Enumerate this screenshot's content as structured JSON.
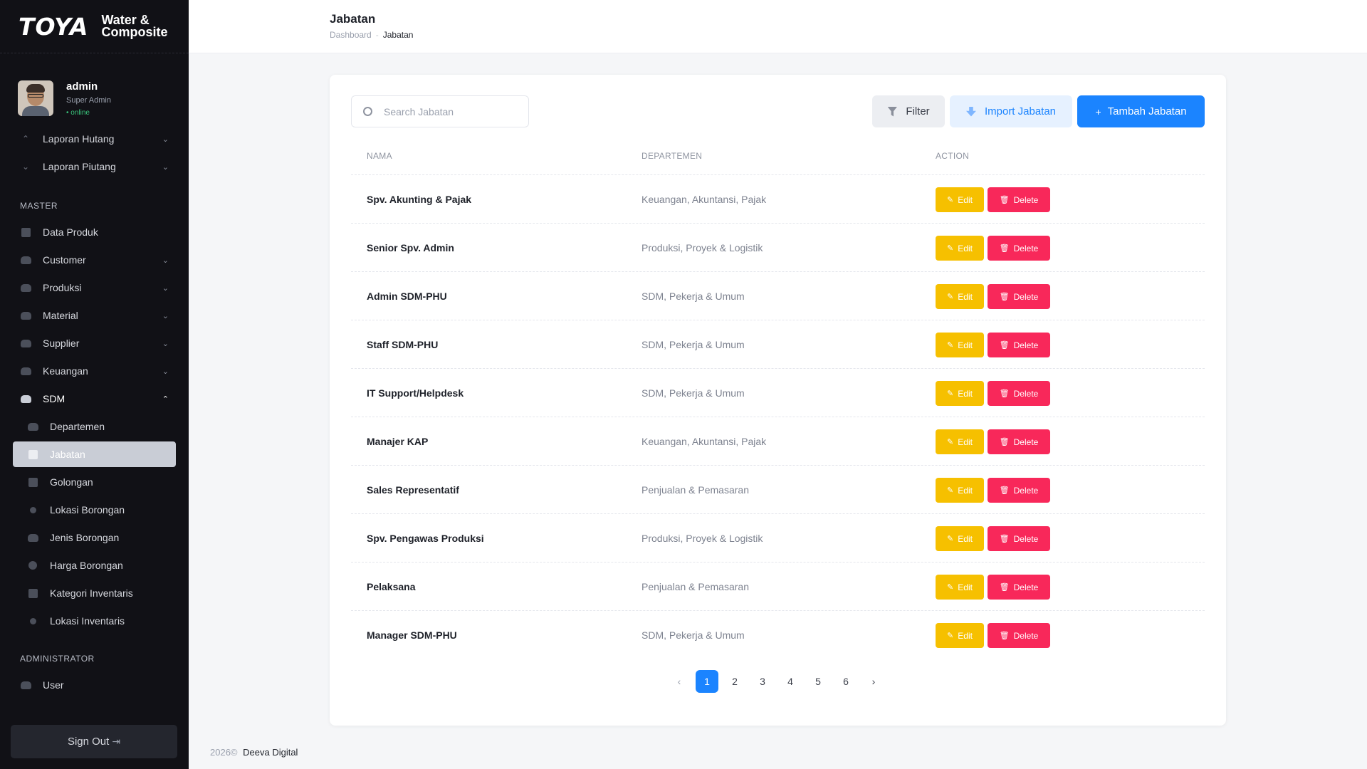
{
  "brand": {
    "logo": "TOYA",
    "subtitle_line1": "Water &",
    "subtitle_line2": "Composite"
  },
  "profile": {
    "name": "admin",
    "role": "Super Admin",
    "status": "• online"
  },
  "sidebar": {
    "top_items": [
      {
        "label": "Laporan Hutang",
        "icon": "arrow-up-icon"
      },
      {
        "label": "Laporan Piutang",
        "icon": "arrow-down-icon"
      }
    ],
    "master_label": "MASTER",
    "master_items": [
      {
        "label": "Data Produk"
      },
      {
        "label": "Customer"
      },
      {
        "label": "Produksi"
      },
      {
        "label": "Material"
      },
      {
        "label": "Supplier"
      },
      {
        "label": "Keuangan"
      },
      {
        "label": "SDM"
      }
    ],
    "sdm_items": [
      {
        "label": "Departemen"
      },
      {
        "label": "Jabatan"
      },
      {
        "label": "Golongan"
      },
      {
        "label": "Lokasi Borongan"
      },
      {
        "label": "Jenis Borongan"
      },
      {
        "label": "Harga Borongan"
      },
      {
        "label": "Kategori Inventaris"
      },
      {
        "label": "Lokasi Inventaris"
      }
    ],
    "admin_label": "ADMINISTRATOR",
    "admin_items": [
      {
        "label": "User"
      }
    ],
    "signout_label": "Sign Out"
  },
  "header": {
    "title": "Jabatan",
    "breadcrumb_home": "Dashboard",
    "breadcrumb_sep": "-",
    "breadcrumb_current": "Jabatan"
  },
  "toolbar": {
    "search_placeholder": "Search Jabatan",
    "filter_label": "Filter",
    "import_label": "Import Jabatan",
    "add_label": "Tambah Jabatan"
  },
  "table": {
    "columns": [
      "NAMA",
      "DEPARTEMEN",
      "ACTION"
    ],
    "edit_label": "Edit",
    "delete_label": "Delete",
    "rows": [
      {
        "nama": "Spv. Akunting & Pajak",
        "departemen": "Keuangan, Akuntansi, Pajak"
      },
      {
        "nama": "Senior Spv. Admin",
        "departemen": "Produksi, Proyek & Logistik"
      },
      {
        "nama": "Admin SDM-PHU",
        "departemen": "SDM, Pekerja & Umum"
      },
      {
        "nama": "Staff SDM-PHU",
        "departemen": "SDM, Pekerja & Umum"
      },
      {
        "nama": "IT Support/Helpdesk",
        "departemen": "SDM, Pekerja & Umum"
      },
      {
        "nama": "Manajer KAP",
        "departemen": "Keuangan, Akuntansi, Pajak"
      },
      {
        "nama": "Sales Representatif",
        "departemen": "Penjualan & Pemasaran"
      },
      {
        "nama": "Spv. Pengawas Produksi",
        "departemen": "Produksi, Proyek & Logistik"
      },
      {
        "nama": "Pelaksana",
        "departemen": "Penjualan & Pemasaran"
      },
      {
        "nama": "Manager SDM-PHU",
        "departemen": "SDM, Pekerja & Umum"
      }
    ]
  },
  "pagination": {
    "prev": "‹",
    "pages": [
      "1",
      "2",
      "3",
      "4",
      "5",
      "6"
    ],
    "current": "1",
    "next": "›"
  },
  "footer": {
    "year": "2026©",
    "company": "Deeva Digital"
  },
  "colors": {
    "primary": "#1b84ff",
    "edit": "#f6c000",
    "delete": "#f8285a",
    "sidebar_bg": "#111116"
  }
}
